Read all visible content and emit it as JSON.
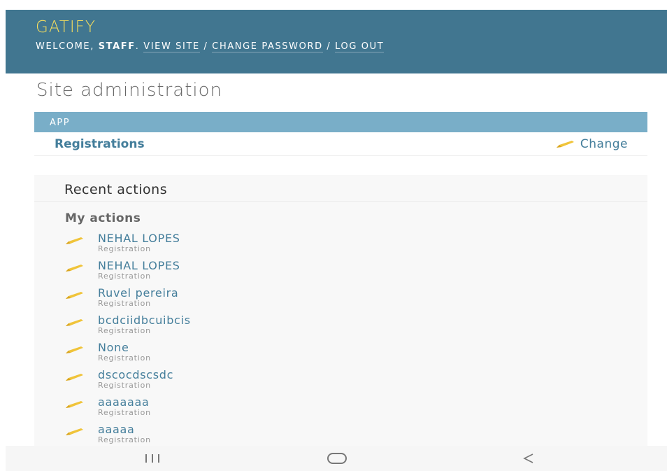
{
  "header": {
    "branding": "GATIFY",
    "welcome": "WELCOME,",
    "username": "STAFF",
    "links": {
      "view_site": "VIEW SITE",
      "change_password": "CHANGE PASSWORD",
      "log_out": "LOG OUT"
    }
  },
  "page_title": "Site administration",
  "app_module": {
    "caption": "APP",
    "model": "Registrations",
    "change_label": "Change"
  },
  "recent_actions": {
    "title": "Recent actions",
    "subtitle": "My actions",
    "items": [
      {
        "name": "NEHAL LOPES",
        "type": "Registration"
      },
      {
        "name": "NEHAL LOPES",
        "type": "Registration"
      },
      {
        "name": "Ruvel pereira",
        "type": "Registration"
      },
      {
        "name": "bcdciidbcuibcis",
        "type": "Registration"
      },
      {
        "name": "None",
        "type": "Registration"
      },
      {
        "name": "dscocdscsdc",
        "type": "Registration"
      },
      {
        "name": "aaaaaaa",
        "type": "Registration"
      },
      {
        "name": "aaaaa",
        "type": "Registration"
      }
    ]
  },
  "colors": {
    "header_bg": "#417690",
    "branding": "#f5dd5d",
    "module_caption_bg": "#79aec8",
    "link": "#447e9b",
    "pencil": "#f0c43a"
  },
  "icons": {
    "pencil": "pencil-icon",
    "nav_recents": "recent-apps-icon",
    "nav_home": "home-icon",
    "nav_back": "back-icon"
  }
}
